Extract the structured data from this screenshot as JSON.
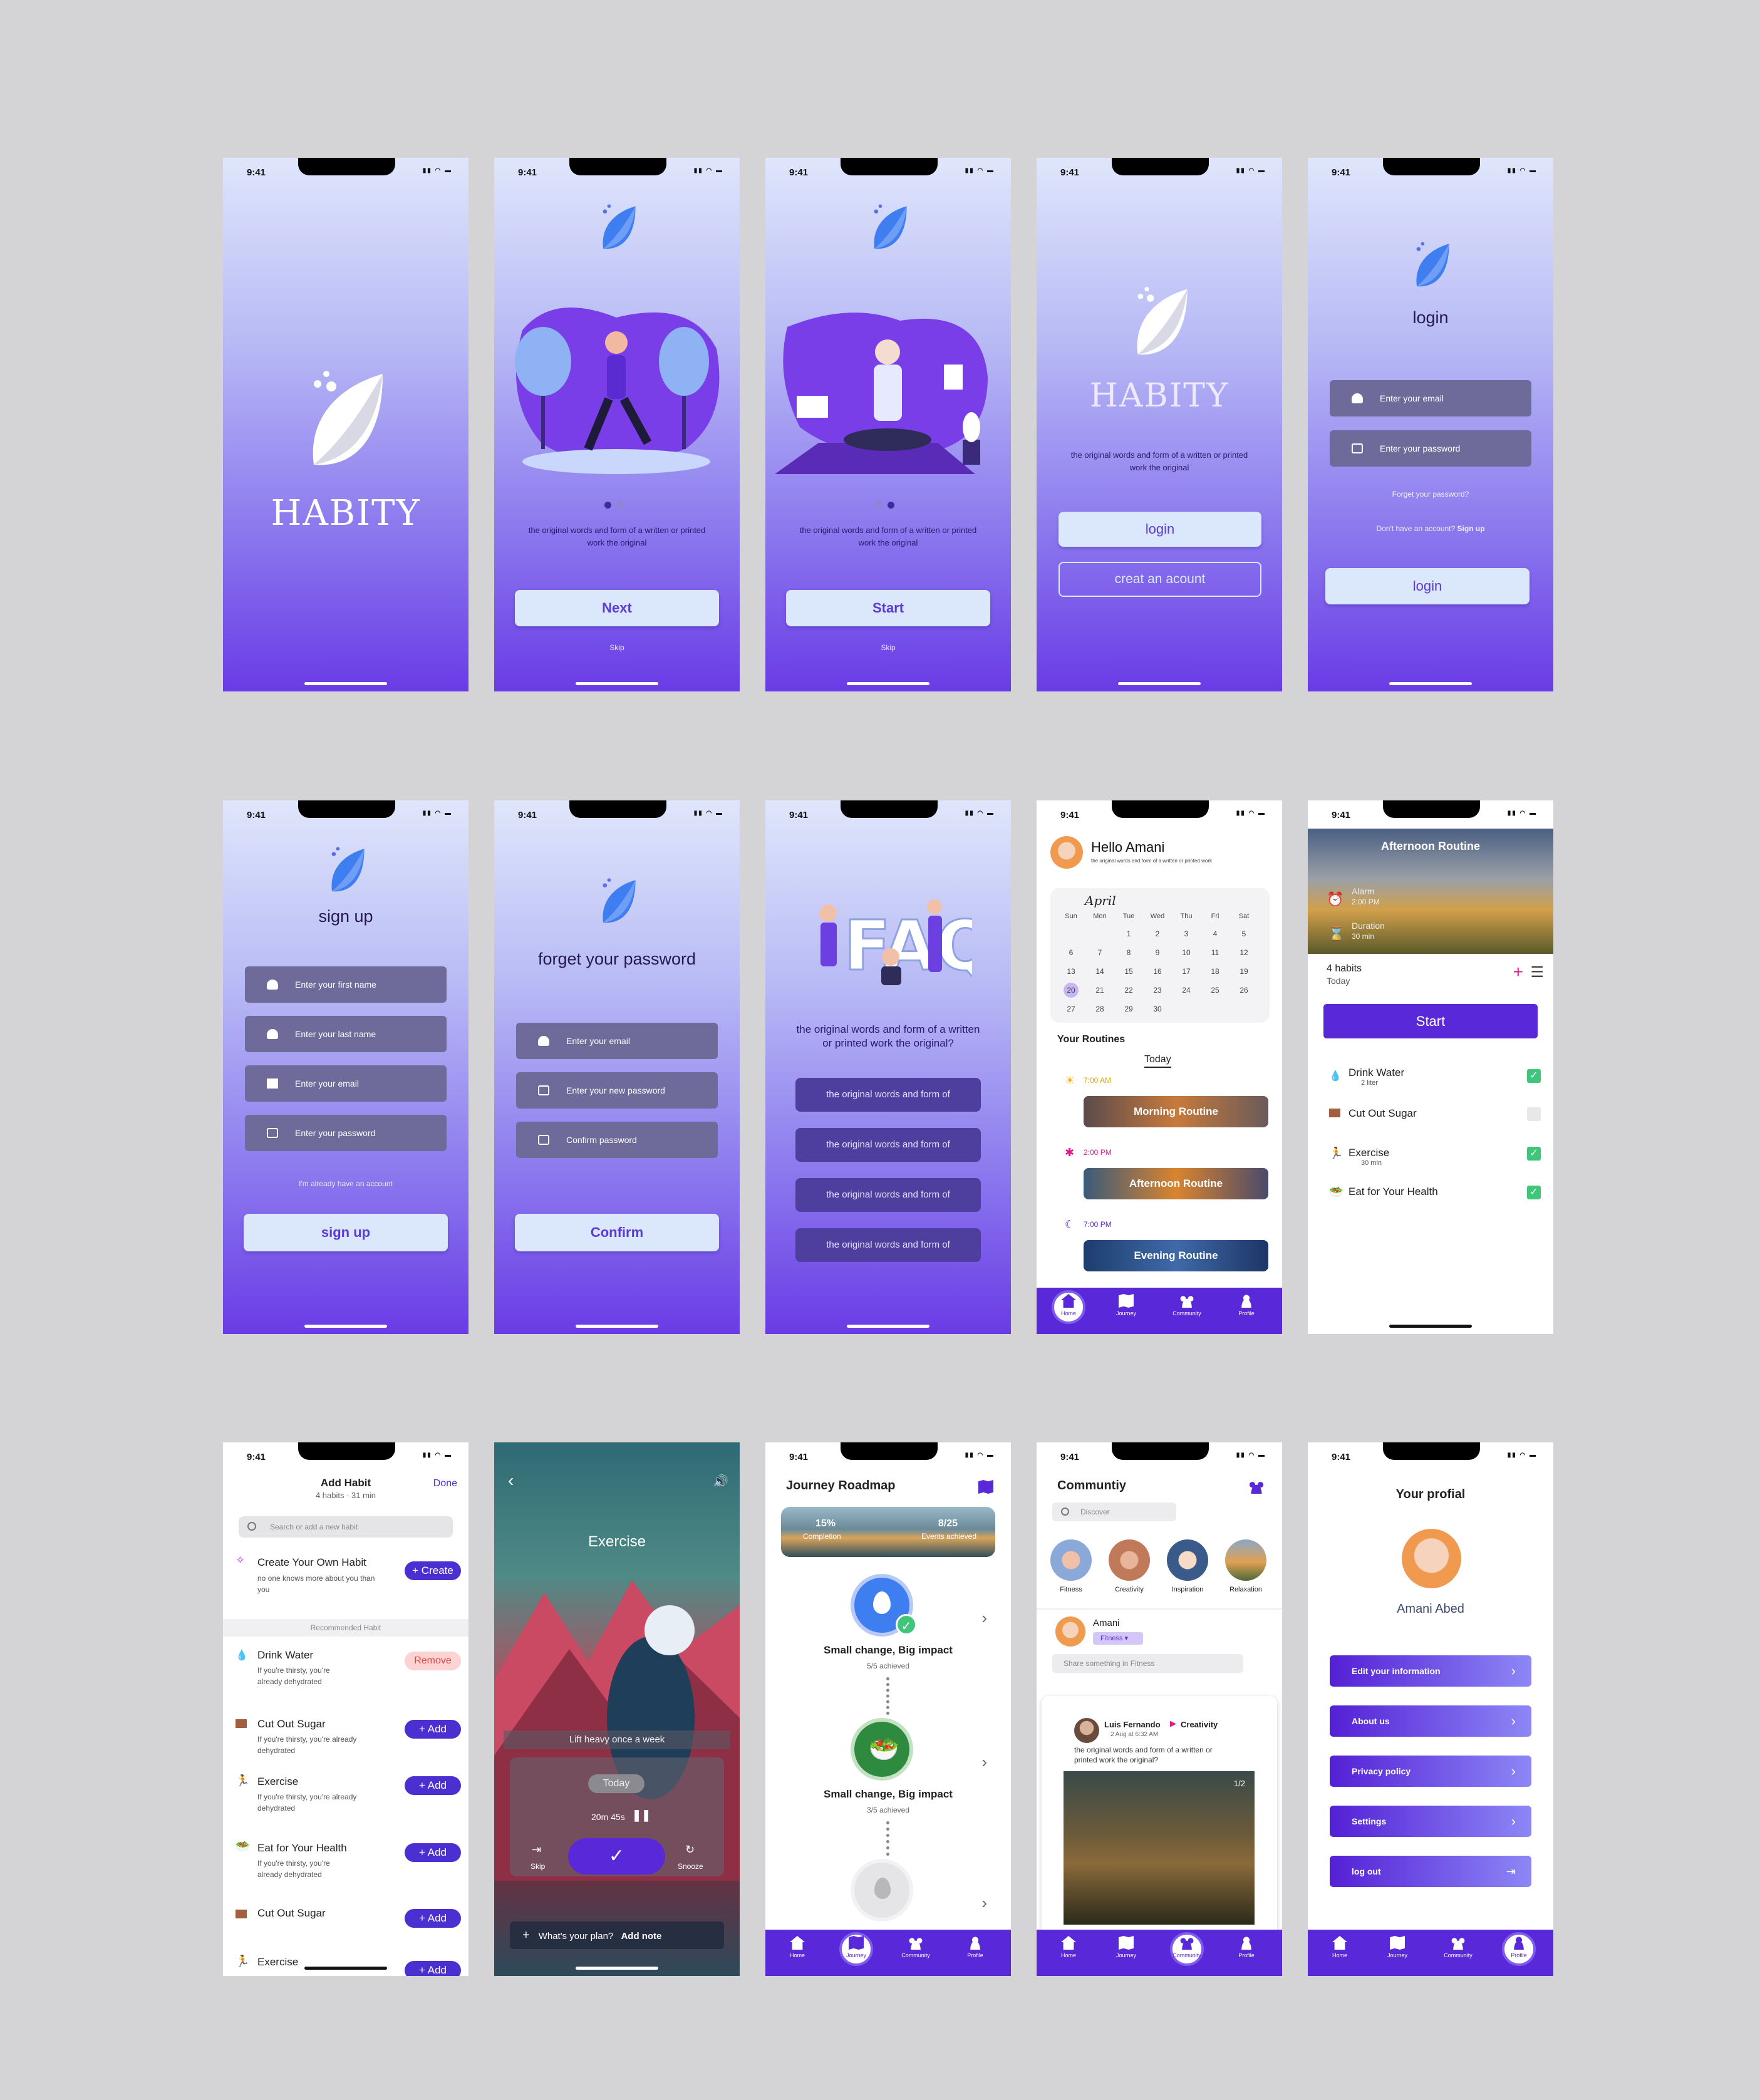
{
  "status_time": "9:41",
  "brand": "HABITY",
  "caption": "the original words and form of a written or printed work the original",
  "onboarding": {
    "next": "Next",
    "start": "Start",
    "skip": "Skip"
  },
  "welcome": {
    "login": "login",
    "create": "creat an acount"
  },
  "login": {
    "title": "login",
    "email": "Enter your email",
    "password": "Enter your password",
    "forgot": "Forget your password?",
    "no_account": "Don't have an account?",
    "signup_link": "Sign up",
    "button": "login"
  },
  "signup": {
    "title": "sign up",
    "first": "Enter your first name",
    "last": "Enter your last name",
    "email": "Enter your email",
    "password": "Enter your password",
    "have_account": "I'm already have an account",
    "button": "sign up"
  },
  "forget": {
    "title": "forget your password",
    "email": "Enter your email",
    "new_pw": "Enter your new password",
    "confirm_pw": "Confirm password",
    "button": "Confirm"
  },
  "faq": {
    "question": "the original words and form of a written or printed work the original?",
    "items": [
      "the original words and form of",
      "the original words and form of",
      "the original words and form of",
      "the original words and form of"
    ]
  },
  "home": {
    "greeting": "Hello Amani",
    "sub": "the original words and form of a written or printed work",
    "month": "April",
    "days": [
      "Sun",
      "Mon",
      "Tue",
      "Wed",
      "Thu",
      "Fri",
      "Sat"
    ],
    "weeks": [
      [
        "",
        "",
        "1",
        "2",
        "3",
        "4",
        "5"
      ],
      [
        "6",
        "7",
        "8",
        "9",
        "10",
        "11",
        "12"
      ],
      [
        "13",
        "14",
        "15",
        "16",
        "17",
        "18",
        "19"
      ],
      [
        "20",
        "21",
        "22",
        "23",
        "24",
        "25",
        "26"
      ],
      [
        "27",
        "28",
        "29",
        "30",
        "",
        "",
        ""
      ]
    ],
    "routines_title": "Your Routines",
    "today": "Today",
    "routines": [
      {
        "time": "7:00 AM",
        "name": "Morning Routine"
      },
      {
        "time": "2:00 PM",
        "name": "Afternoon Routine"
      },
      {
        "time": "7:00 PM",
        "name": "Evening Routine"
      }
    ]
  },
  "nav": {
    "home": "Home",
    "journey": "Journey",
    "community": "Community",
    "profile": "Profile"
  },
  "afternoon": {
    "title": "Afternoon Routine",
    "alarm_label": "Alarm",
    "alarm": "2:00 PM",
    "duration_label": "Duration",
    "duration": "30 min",
    "count": "4 habits",
    "day": "Today",
    "start": "Start",
    "habits": [
      {
        "name": "Drink Water",
        "sub": "2 liter",
        "done": true
      },
      {
        "name": "Cut Out Sugar",
        "sub": "",
        "done": false
      },
      {
        "name": "Exercise",
        "sub": "30 min",
        "done": true
      },
      {
        "name": "Eat for Your Health",
        "sub": "",
        "done": true
      }
    ]
  },
  "add_habit": {
    "title": "Add Habit",
    "meta": "4 habits · 31 min",
    "done": "Done",
    "search": "Search or add a new habit",
    "create_title": "Create Your Own Habit",
    "create_sub": "no one knows more about you than you",
    "create_btn": "+ Create",
    "recommended": "Recommended Habit",
    "remove": "Remove",
    "add": "+ Add",
    "items": [
      {
        "name": "Drink Water",
        "sub": "If you're thirsty, you're already dehydrated"
      },
      {
        "name": "Cut Out Sugar",
        "sub": "If you're thirsty, you're already dehydrated"
      },
      {
        "name": "Exercise",
        "sub": "If you're thirsty, you're already dehydrated"
      },
      {
        "name": "Eat for Your Health",
        "sub": "If you're thirsty, you're already dehydrated"
      },
      {
        "name": "Cut Out Sugar",
        "sub": ""
      },
      {
        "name": "Exercise",
        "sub": ""
      }
    ]
  },
  "exercise": {
    "title": "Exercise",
    "goal": "Lift heavy once a week",
    "today": "Today",
    "timer": "20m 45s",
    "skip": "Skip",
    "snooze": "Snooze",
    "plan": "What's your plan?",
    "add_note": "Add note"
  },
  "journey": {
    "title": "Journey Roadmap",
    "completion_val": "15%",
    "completion_label": "Completion",
    "events_val": "8/25",
    "events_label": "Events achieved",
    "steps": [
      {
        "title": "Small change, Big impact",
        "sub": "5/5 achieved"
      },
      {
        "title": "Small change, Big impact",
        "sub": "3/5 achieved"
      }
    ]
  },
  "community": {
    "title": "Communtiy",
    "discover": "Discover",
    "cats": [
      "Fitness",
      "Creativity",
      "Inspiration",
      "Relaxation"
    ],
    "user": "Amani",
    "tag": "Fitness",
    "share": "Share something in Fitness",
    "post_user": "Luis Fernando",
    "post_cat": "Creativity",
    "post_date": "2 Aug at 6:32 AM",
    "post_text": "the original words and form of a written or printed work the original?",
    "post_count": "1/2"
  },
  "profile": {
    "title": "Your profial",
    "name": "Amani Abed",
    "menu": [
      "Edit your information",
      "About us",
      "Privacy policy",
      "Settings",
      "log out"
    ]
  },
  "colors": {
    "primary": "#5928d8",
    "accent": "#4b2fd1",
    "light": "#dbe7fb"
  }
}
